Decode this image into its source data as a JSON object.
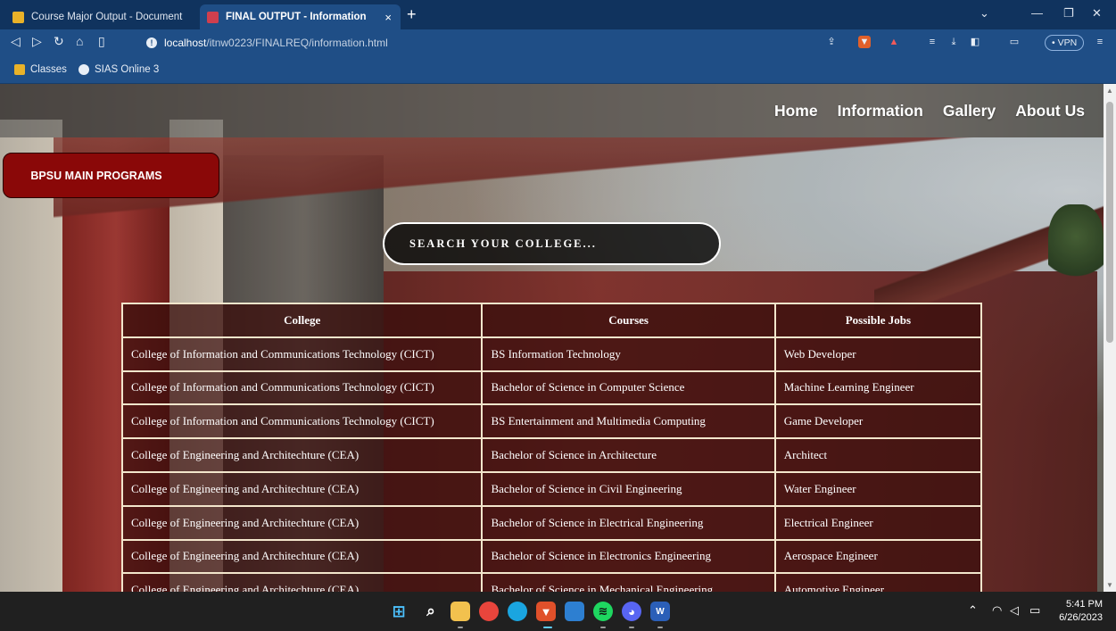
{
  "browser": {
    "tabs": [
      {
        "label": "Course Major Output - Document",
        "active": false
      },
      {
        "label": "FINAL OUTPUT - Information",
        "active": true
      }
    ],
    "close_glyph": "×",
    "new_tab_glyph": "+",
    "url_host": "localhost",
    "url_path": "/itnw0223/FINALREQ/information.html",
    "vpn_label": "• VPN",
    "bookmarks": [
      "Classes",
      "SIAS Online 3"
    ]
  },
  "site": {
    "nav": [
      "Home",
      "Information",
      "Gallery",
      "About Us"
    ],
    "programs_button": "BPSU MAIN PROGRAMS",
    "search_placeholder": "SEARCH YOUR COLLEGE...",
    "table": {
      "headers": [
        "College",
        "Courses",
        "Possible Jobs"
      ],
      "rows": [
        [
          "College of Information and Communications Technology (CICT)",
          "BS Information Technology",
          "Web Developer"
        ],
        [
          "College of Information and Communications Technology (CICT)",
          "Bachelor of Science in Computer Science",
          "Machine Learning Engineer"
        ],
        [
          "College of Information and Communications Technology (CICT)",
          "BS Entertainment and Multimedia Computing",
          "Game Developer"
        ],
        [
          "College of Engineering and Architechture (CEA)",
          "Bachelor of Science in Architecture",
          "Architect"
        ],
        [
          "College of Engineering and Architechture (CEA)",
          "Bachelor of Science in Civil Engineering",
          "Water Engineer"
        ],
        [
          "College of Engineering and Architechture (CEA)",
          "Bachelor of Science in Electrical Engineering",
          "Electrical Engineer"
        ],
        [
          "College of Engineering and Architechture (CEA)",
          "Bachelor of Science in Electronics Engineering",
          "Aerospace Engineer"
        ],
        [
          "College of Engineering and Architechture (CEA)",
          "Bachelor of Science in Mechanical Engineering",
          "Automotive Engineer"
        ]
      ]
    }
  },
  "taskbar": {
    "time": "5:41 PM",
    "date": "6/26/2023"
  },
  "colors": {
    "programs_button_bg": "#8a0808",
    "table_cell_bg": "#3a0e0c",
    "table_border": "#f3e6cc",
    "browser_chrome": "#1f4e86"
  }
}
